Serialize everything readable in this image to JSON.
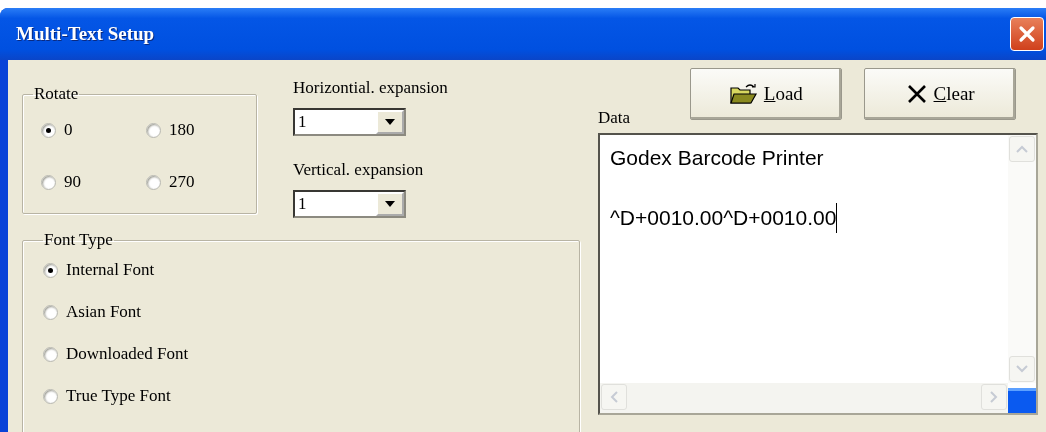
{
  "window": {
    "title": "Multi-Text Setup"
  },
  "rotate": {
    "label": "Rotate",
    "options": [
      {
        "label": "0",
        "selected": true
      },
      {
        "label": "180",
        "selected": false
      },
      {
        "label": "90",
        "selected": false
      },
      {
        "label": "270",
        "selected": false
      }
    ]
  },
  "horizontal_expansion": {
    "label": "Horizontial. expansion",
    "value": "1"
  },
  "vertical_expansion": {
    "label": "Vertical. expansion",
    "value": "1"
  },
  "font_type": {
    "label": "Font Type",
    "options": [
      {
        "label": "Internal Font",
        "selected": true
      },
      {
        "label": "Asian Font",
        "selected": false
      },
      {
        "label": "Downloaded Font",
        "selected": false
      },
      {
        "label": "True Type Font",
        "selected": false
      }
    ]
  },
  "data": {
    "label": "Data",
    "lines": [
      "Godex Barcode Printer",
      "^D+0010.00^D+0010.00"
    ]
  },
  "buttons": [
    {
      "kind": "load",
      "label": "Load"
    },
    {
      "kind": "clear",
      "label": "Clear"
    }
  ]
}
